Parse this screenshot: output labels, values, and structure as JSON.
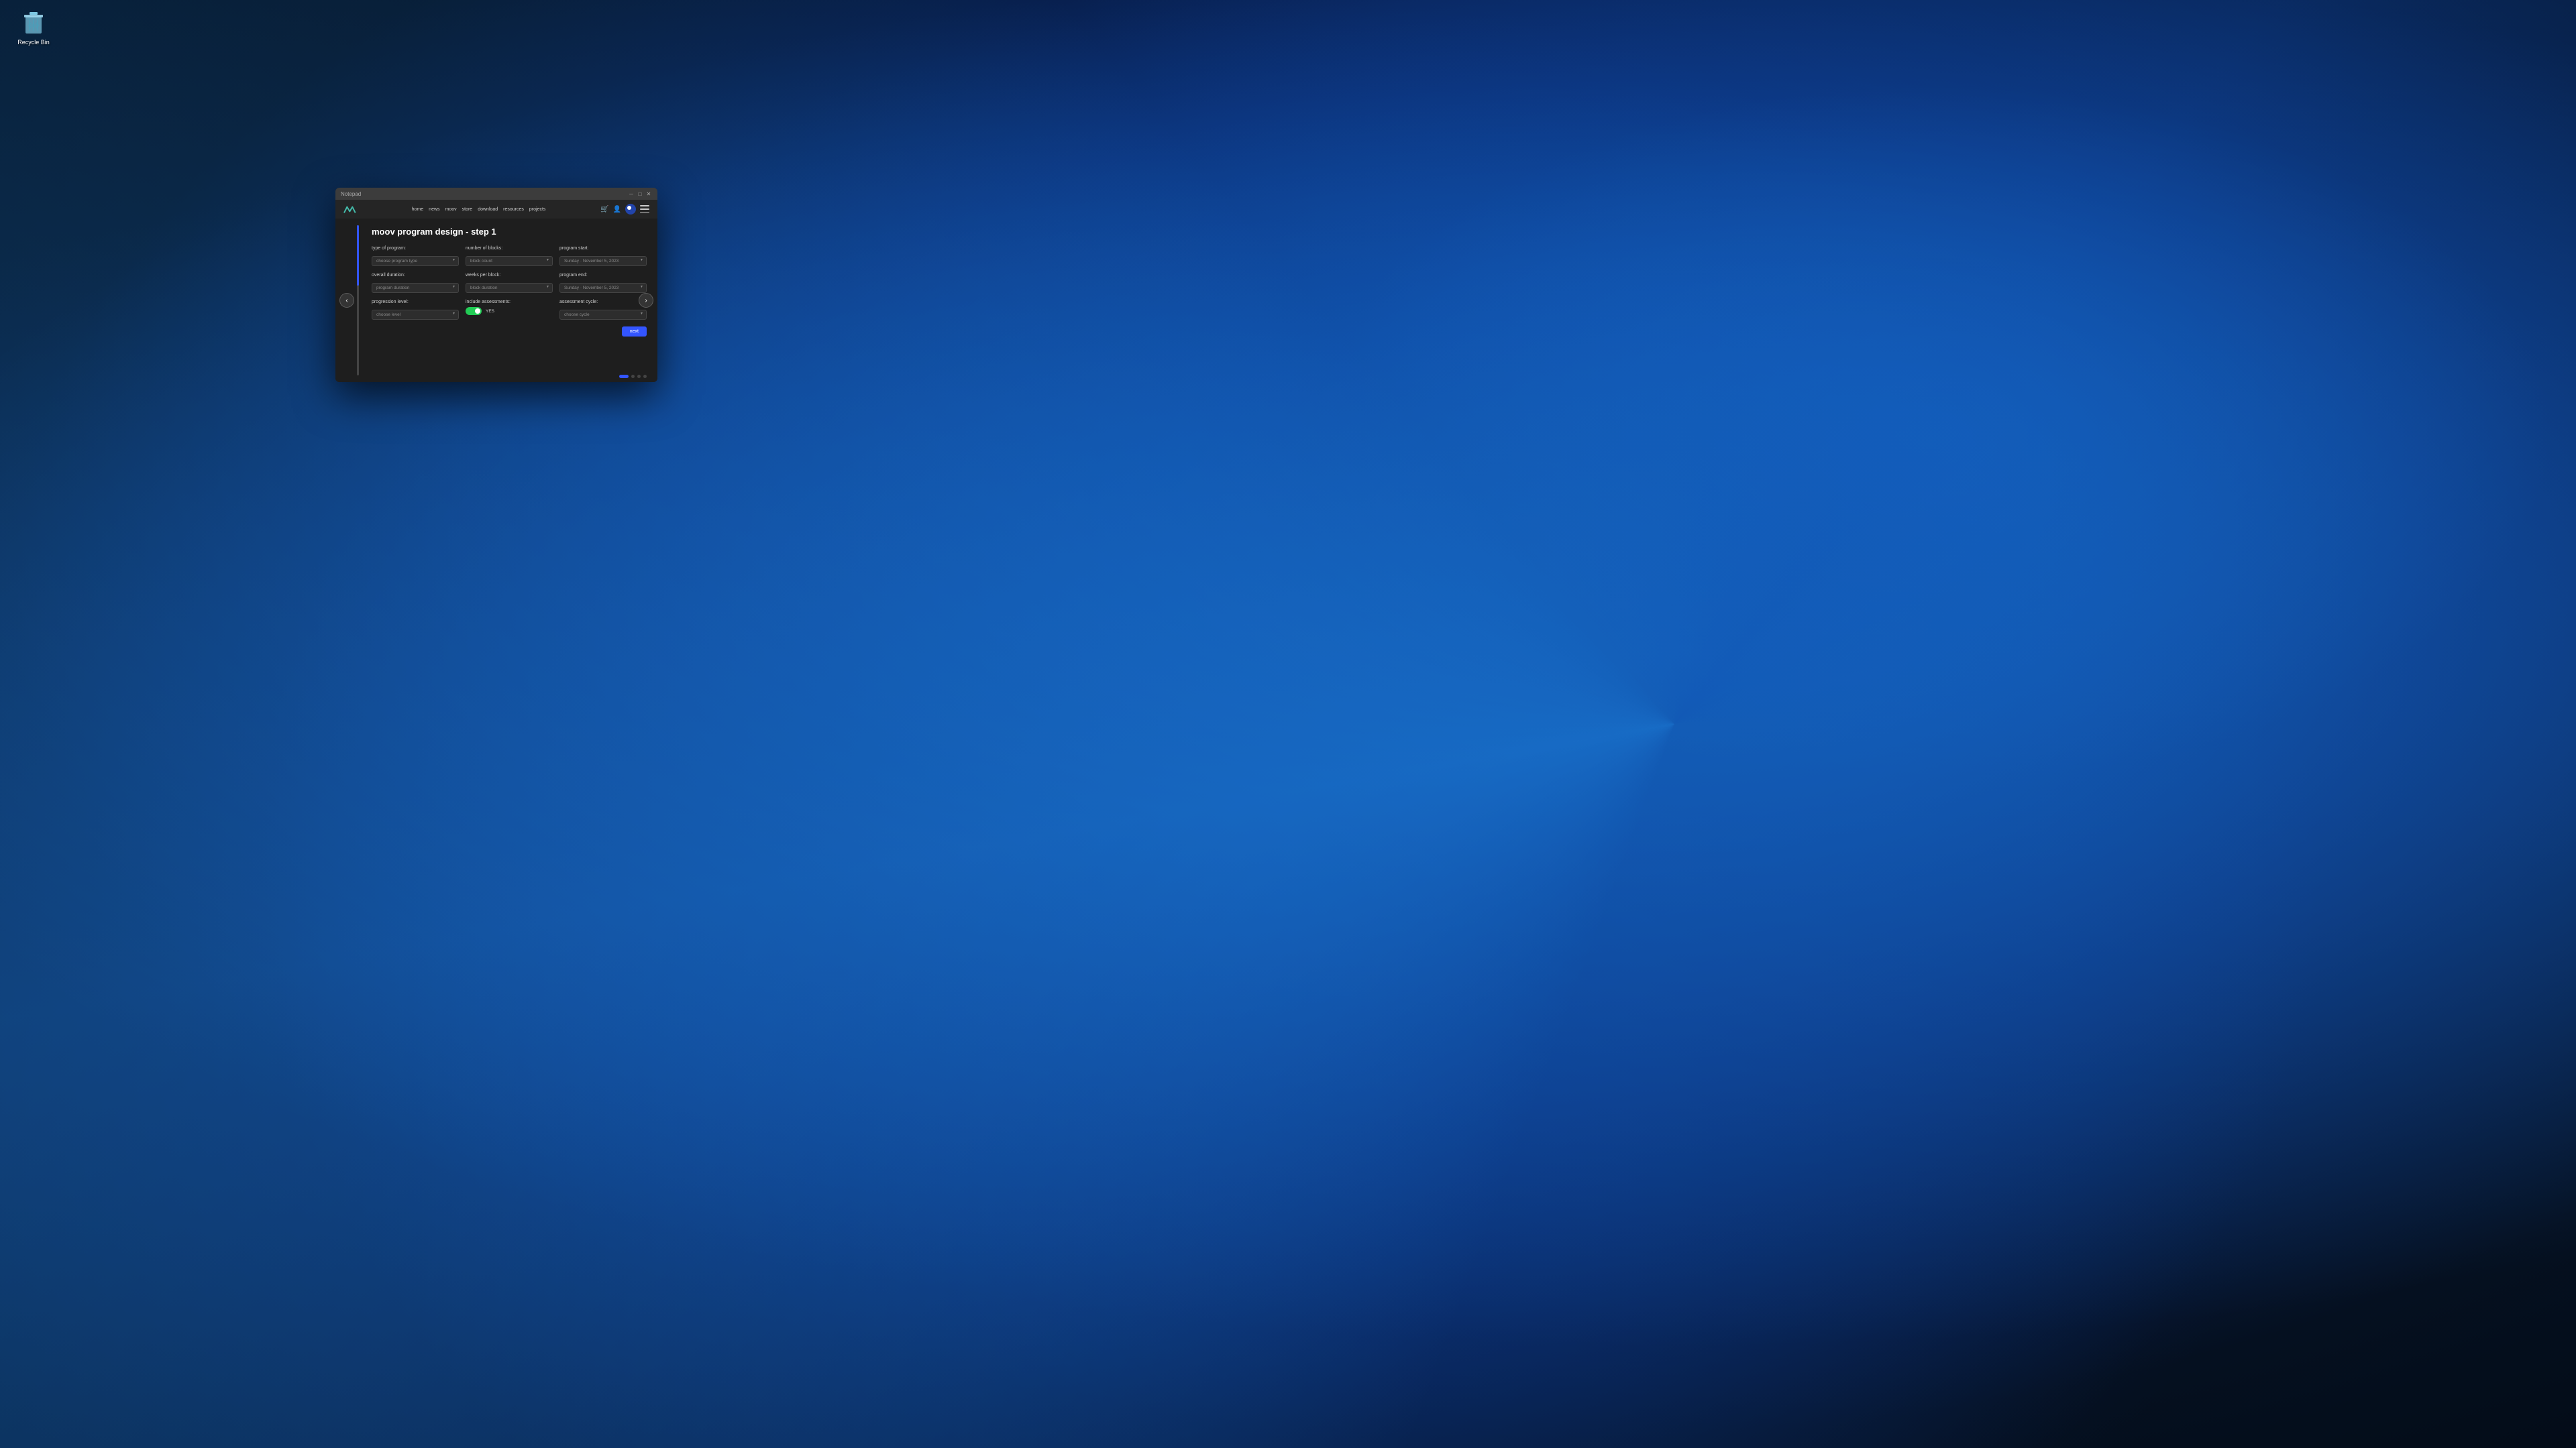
{
  "desktop": {
    "recycle_bin": {
      "label": "Recycle Bin"
    }
  },
  "browser": {
    "titlebar_text": "Notepad",
    "window_controls": {
      "minimize": "—",
      "maximize": "□",
      "close": "✕"
    }
  },
  "nav": {
    "links": [
      {
        "label": "home"
      },
      {
        "label": "news"
      },
      {
        "label": "moov"
      },
      {
        "label": "store"
      },
      {
        "label": "download"
      },
      {
        "label": "resources"
      },
      {
        "label": "projects"
      }
    ]
  },
  "page": {
    "title": "moov program design - step 1",
    "form": {
      "type_of_program": {
        "label": "type of program:",
        "placeholder": "choose program type"
      },
      "number_of_blocks": {
        "label": "number of blocks:",
        "placeholder": "block count"
      },
      "program_start": {
        "label": "program start:",
        "value": "Sunday  ·  November 5, 2023"
      },
      "overall_duration": {
        "label": "overall duration:",
        "placeholder": "program duration"
      },
      "weeks_per_block": {
        "label": "weeks per block:",
        "placeholder": "block duration"
      },
      "program_end": {
        "label": "program end:",
        "value": "Sunday  ·  November 5, 2023"
      },
      "progression_level": {
        "label": "progression level:",
        "placeholder": "choose level"
      },
      "include_assessments": {
        "label": "include assessments:",
        "toggle_state": true,
        "toggle_label": "YES"
      },
      "assessment_cycle": {
        "label": "assessment cycle:",
        "placeholder": "choose cycle"
      }
    },
    "buttons": {
      "next": "next"
    },
    "progress": {
      "dots": [
        {
          "active": true
        },
        {
          "active": false
        },
        {
          "active": false
        },
        {
          "active": false
        }
      ]
    }
  }
}
